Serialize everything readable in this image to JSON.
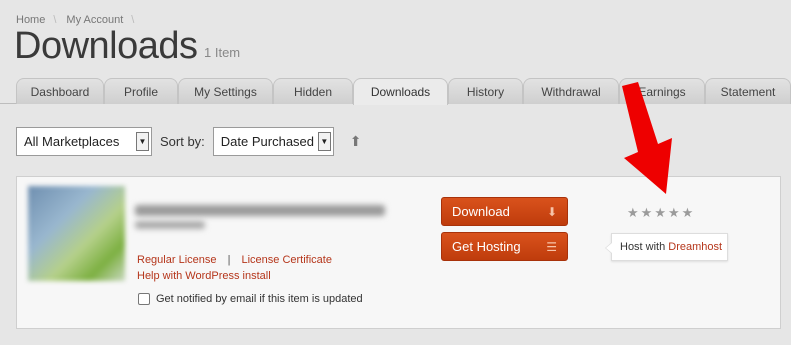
{
  "breadcrumb": {
    "items": [
      "Home",
      "My Account"
    ]
  },
  "page": {
    "title": "Downloads",
    "count": "1 Item"
  },
  "tabs": [
    {
      "label": "Dashboard"
    },
    {
      "label": "Profile"
    },
    {
      "label": "My Settings"
    },
    {
      "label": "Hidden"
    },
    {
      "label": "Downloads",
      "active": true
    },
    {
      "label": "History"
    },
    {
      "label": "Withdrawal"
    },
    {
      "label": "Earnings"
    },
    {
      "label": "Statement"
    }
  ],
  "filters": {
    "marketplace": {
      "selected": "All Marketplaces"
    },
    "sort_label": "Sort by:",
    "sort": {
      "selected": "Date Purchased"
    }
  },
  "item": {
    "license_regular": "Regular License",
    "license_separator": "|",
    "license_certificate": "License Certificate",
    "help_link": "Help with WordPress install",
    "notify_label": "Get notified by email if this item is updated",
    "notify_checked": false,
    "download_label": "Download",
    "hosting_label": "Get Hosting",
    "rating": {
      "value": 0,
      "max": 5
    },
    "tooltip": {
      "prefix": "Host with",
      "host": "Dreamhost"
    }
  },
  "icons": {
    "download": "arrow-down-icon",
    "hosting": "server-icon",
    "sort": "arrow-up-icon",
    "star": "star-icon",
    "annotation": "red-arrow"
  },
  "colors": {
    "accent": "#c9461a",
    "link": "#b5361b",
    "annotation": "#ee0000"
  }
}
